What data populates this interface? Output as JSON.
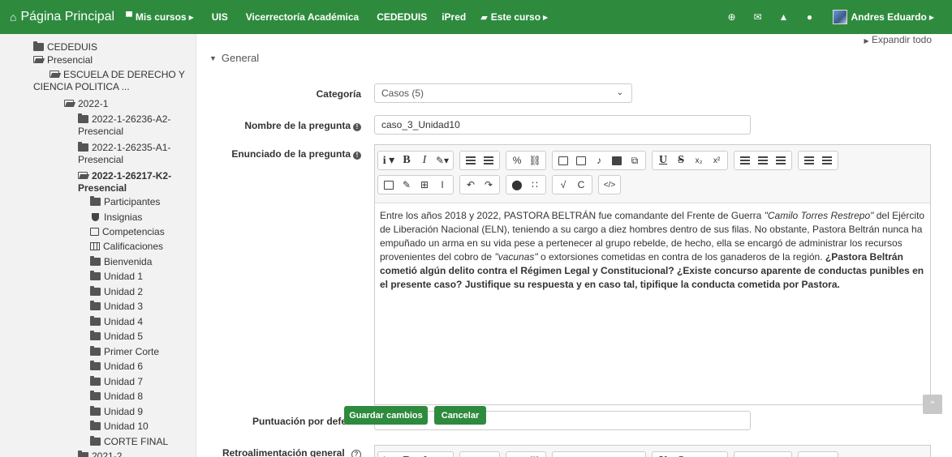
{
  "navbar": {
    "home_label": "Página Principal",
    "my_courses_label": "Mis cursos",
    "links": [
      "UIS",
      "Vicerrectoría Académica",
      "CEDEDUIS",
      "iPred"
    ],
    "this_course_label": "Este curso",
    "user_name": "Andres Eduardo",
    "brand_color": "#2e8b3e"
  },
  "sidebar": {
    "items": [
      {
        "label": "CEDEDUIS",
        "icon": "folder-closed-icon"
      },
      {
        "label": "Presencial",
        "icon": "folder-open-icon"
      },
      {
        "label": "ESCUELA DE DERECHO Y",
        "label2": "CIENCIA POLITICA ...",
        "icon": "folder-open-icon"
      },
      {
        "label": "2022-1",
        "icon": "folder-open-icon"
      },
      {
        "label": "2022-1-26236-A2-",
        "label2": "Presencial",
        "icon": "folder-closed-icon"
      },
      {
        "label": "2022-1-26235-A1-",
        "label2": "Presencial",
        "icon": "folder-closed-icon"
      },
      {
        "label": "2022-1-26217-K2-",
        "label2": "Presencial",
        "icon": "folder-open-icon"
      },
      {
        "label": "Participantes",
        "icon": "folder-closed-icon"
      },
      {
        "label": "Insignias",
        "icon": "shield-icon"
      },
      {
        "label": "Competencias",
        "icon": "checkbox-icon"
      },
      {
        "label": "Calificaciones",
        "icon": "table-icon"
      },
      {
        "label": "Bienvenida",
        "icon": "folder-closed-icon"
      },
      {
        "label": "Unidad 1",
        "icon": "folder-closed-icon"
      },
      {
        "label": "Unidad 2",
        "icon": "folder-closed-icon"
      },
      {
        "label": "Unidad 3",
        "icon": "folder-closed-icon"
      },
      {
        "label": "Unidad 4",
        "icon": "folder-closed-icon"
      },
      {
        "label": "Unidad 5",
        "icon": "folder-closed-icon"
      },
      {
        "label": "Primer Corte",
        "icon": "folder-closed-icon"
      },
      {
        "label": "Unidad 6",
        "icon": "folder-closed-icon"
      },
      {
        "label": "Unidad 7",
        "icon": "folder-closed-icon"
      },
      {
        "label": "Unidad 8",
        "icon": "folder-closed-icon"
      },
      {
        "label": "Unidad 9",
        "icon": "folder-closed-icon"
      },
      {
        "label": "Unidad 10",
        "icon": "folder-closed-icon"
      },
      {
        "label": "CORTE FINAL",
        "icon": "folder-closed-icon"
      },
      {
        "label": "2021-2",
        "icon": "folder-closed-icon"
      }
    ]
  },
  "main": {
    "expand_all": "Expandir todo",
    "section_title": "General",
    "category_label": "Categoría",
    "category_value": "Casos (5)",
    "question_name_label": "Nombre de la pregunta",
    "question_name_value": "caso_3_Unidad10",
    "question_text_label": "Enunciado de la pregunta",
    "question_text": {
      "p1": "Entre los años 2018 y 2022, PASTORA BELTRÁN fue comandante del Frente de Guerra ",
      "em1": "\"Camilo Torres Restrepo\"",
      "p2": " del Ejército de Liberación Nacional (ELN), teniendo a su cargo a diez hombres dentro de sus filas. No obstante, Pastora Beltrán nunca ha empuñado un arma en su vida pese a pertenecer al grupo rebelde, de hecho, ella se encargó de administrar los recursos provenientes del cobro de ",
      "em2": "\"vacunas\"",
      "p3": " o extorsiones cometidas en contra de los ganaderos de la región. ",
      "bold": "¿Pastora Beltrán cometió algún delito contra el Régimen Legal y Constitucional? ¿Existe concurso aparente de conductas punibles en el presente caso? Justifique su respuesta y en caso tal, tipifique la conducta cometida por Pastora."
    },
    "default_mark_label": "Puntuación por defecto",
    "general_feedback_label": "Retroalimentación general",
    "save_button": "Guardar cambios",
    "cancel_button": "Cancelar"
  }
}
